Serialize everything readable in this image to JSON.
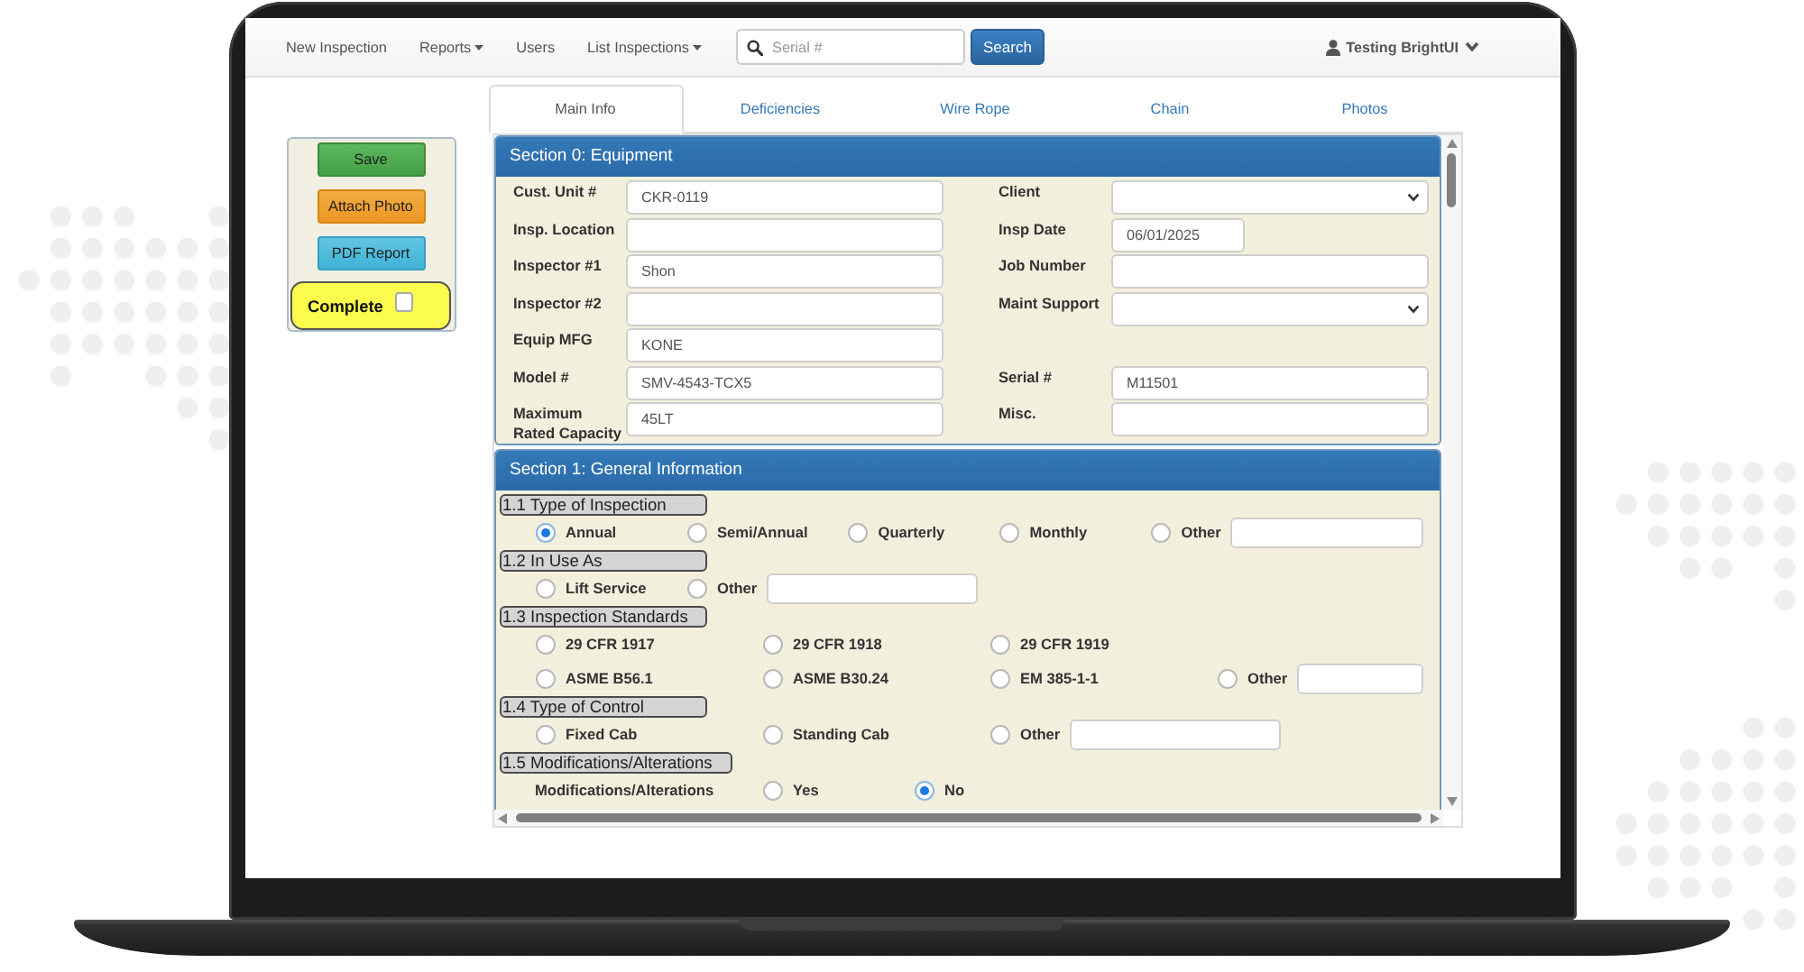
{
  "nav": {
    "links": [
      {
        "label": "New Inspection",
        "dropdown": false
      },
      {
        "label": "Reports",
        "dropdown": true
      },
      {
        "label": "Users",
        "dropdown": false
      },
      {
        "label": "List Inspections",
        "dropdown": true
      }
    ],
    "search": {
      "placeholder": "Serial #",
      "button": "Search"
    },
    "user": {
      "name": "Testing BrightUI"
    }
  },
  "actions": {
    "buttons": [
      {
        "label": "Save",
        "kind": "success"
      },
      {
        "label": "Attach Photo",
        "kind": "warning"
      },
      {
        "label": "PDF Report",
        "kind": "info"
      }
    ],
    "complete": {
      "label": "Complete",
      "checked": false
    }
  },
  "tabs": [
    {
      "label": "Main Info",
      "selected": true
    },
    {
      "label": "Deficiencies",
      "selected": false
    },
    {
      "label": "Wire Rope",
      "selected": false
    },
    {
      "label": "Chain",
      "selected": false
    },
    {
      "label": "Photos",
      "selected": false
    }
  ],
  "equipment_section": {
    "title": "Section 0: Equipment",
    "rows": [
      {
        "left": {
          "label": "Cust. Unit #",
          "kind": "text",
          "value": "CKR-0119"
        },
        "right": {
          "label": "Client",
          "kind": "select"
        }
      },
      {
        "left": {
          "label": "Insp. Location",
          "kind": "text"
        },
        "right": {
          "label": "Insp Date",
          "kind": "date",
          "value": "06/01/2025"
        }
      },
      {
        "left": {
          "label": "Inspector #1",
          "kind": "text",
          "value": "Shon"
        },
        "right": {
          "label": "Job Number",
          "kind": "text"
        }
      },
      {
        "left": {
          "label": "Inspector #2",
          "kind": "text"
        },
        "right": {
          "label": "Maint Support",
          "kind": "select"
        }
      },
      {
        "left": {
          "label": "Equip MFG",
          "kind": "text",
          "value": "KONE"
        }
      },
      {
        "left": {
          "label": "Model #",
          "kind": "text",
          "value": "SMV-4543-TCX5"
        },
        "right": {
          "label": "Serial #",
          "kind": "text",
          "value": "M11501"
        }
      },
      {
        "left": {
          "label": "Maximum Rated Capacity",
          "kind": "text",
          "value": "45LT"
        },
        "right": {
          "label": "Misc.",
          "kind": "text"
        }
      }
    ]
  },
  "general_section": {
    "title": "Section 1: General Information",
    "groups": [
      {
        "heading": "1.1 Type of Inspection",
        "kind": "inline",
        "rows": [
          {
            "options": [
              {
                "label": "Annual",
                "kind": "radio",
                "selected": true
              },
              {
                "label": "Semi/Annual",
                "kind": "radio",
                "selected": false
              },
              {
                "label": "Quarterly",
                "kind": "radio",
                "selected": false
              },
              {
                "label": "Monthly",
                "kind": "radio",
                "selected": false
              },
              {
                "label": "Other",
                "kind": "other",
                "selected": false
              }
            ]
          }
        ]
      },
      {
        "heading": "1.2 In Use As",
        "kind": "inline",
        "rows": [
          {
            "options": [
              {
                "label": "Lift Service",
                "kind": "radio",
                "selected": false
              },
              {
                "label": "Other",
                "kind": "other",
                "selected": false
              }
            ]
          }
        ]
      },
      {
        "heading": "1.3 Inspection Standards",
        "kind": "columns",
        "rows": [
          {
            "options": [
              {
                "label": "29 CFR 1917",
                "kind": "radio",
                "selected": false
              },
              {
                "label": "29 CFR 1918",
                "kind": "radio",
                "selected": false
              },
              {
                "label": "29 CFR 1919",
                "kind": "radio",
                "selected": false
              }
            ]
          },
          {
            "options": [
              {
                "label": "ASME B56.1",
                "kind": "radio",
                "selected": false
              },
              {
                "label": "ASME B30.24",
                "kind": "radio",
                "selected": false
              },
              {
                "label": "EM 385-1-1",
                "kind": "radio",
                "selected": false
              },
              {
                "label": "Other",
                "kind": "other",
                "selected": false
              }
            ]
          }
        ]
      },
      {
        "heading": "1.4 Type of Control",
        "kind": "columns",
        "rows": [
          {
            "options": [
              {
                "label": "Fixed Cab",
                "kind": "radio",
                "selected": false
              },
              {
                "label": "Standing Cab",
                "kind": "radio",
                "selected": false
              },
              {
                "label": "Other",
                "kind": "other",
                "selected": false
              }
            ]
          }
        ]
      },
      {
        "heading": "1.5 Modifications/Alterations",
        "kind": "inline",
        "rows": [
          {
            "label": "Modifications/Alterations",
            "options": [
              {
                "label": "Yes",
                "kind": "radio",
                "selected": false
              },
              {
                "label": "No",
                "kind": "radio",
                "selected": true
              }
            ]
          }
        ]
      }
    ]
  }
}
